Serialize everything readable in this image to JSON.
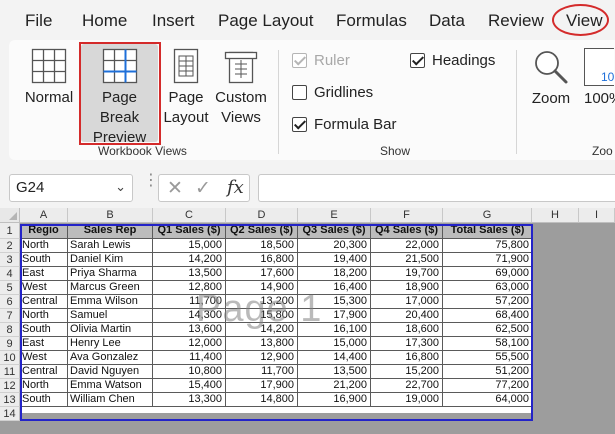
{
  "menu": {
    "items": [
      "File",
      "Home",
      "Insert",
      "Page Layout",
      "Formulas",
      "Data",
      "Review",
      "View"
    ],
    "active": "View"
  },
  "ribbon": {
    "workbook_views": {
      "label": "Workbook Views",
      "buttons": [
        {
          "line1": "Normal",
          "line2": "",
          "icon": "normal-view-icon"
        },
        {
          "line1": "Page Break",
          "line2": "Preview",
          "icon": "page-break-preview-icon",
          "selected": true
        },
        {
          "line1": "Page",
          "line2": "Layout",
          "icon": "page-layout-icon"
        },
        {
          "line1": "Custom",
          "line2": "Views",
          "icon": "custom-views-icon"
        }
      ]
    },
    "show": {
      "label": "Show",
      "ruler": {
        "label": "Ruler",
        "checked": true,
        "disabled": true
      },
      "gridlines": {
        "label": "Gridlines",
        "checked": false
      },
      "formula_bar": {
        "label": "Formula Bar",
        "checked": true
      },
      "headings": {
        "label": "Headings",
        "checked": true
      }
    },
    "zoom": {
      "label": "Zoo",
      "zoom_label": "Zoom",
      "hundred_label": "100%",
      "hundred_icon_text": "10"
    }
  },
  "formula_bar": {
    "name_box": "G24",
    "formula": "",
    "fx": "fx"
  },
  "grid": {
    "columns": [
      "A",
      "B",
      "C",
      "D",
      "E",
      "F",
      "G",
      "H",
      "I"
    ],
    "rows": [
      "1",
      "2",
      "3",
      "4",
      "5",
      "6",
      "7",
      "8",
      "9",
      "10",
      "11",
      "12",
      "13",
      "14"
    ],
    "watermark": "Page 1",
    "headers": [
      "Regio",
      "Sales Rep",
      "Q1 Sales ($)",
      "Q2 Sales ($)",
      "Q3 Sales ($)",
      "Q4 Sales ($)",
      "Total Sales ($)"
    ],
    "data": [
      [
        "North",
        "Sarah Lewis",
        "15,000",
        "18,500",
        "20,300",
        "22,000",
        "75,800"
      ],
      [
        "South",
        "Daniel Kim",
        "14,200",
        "16,800",
        "19,400",
        "21,500",
        "71,900"
      ],
      [
        "East",
        "Priya Sharma",
        "13,500",
        "17,600",
        "18,200",
        "19,700",
        "69,000"
      ],
      [
        "West",
        "Marcus Green",
        "12,800",
        "14,900",
        "16,400",
        "18,900",
        "63,000"
      ],
      [
        "Central",
        "Emma Wilson",
        "11,700",
        "13,200",
        "15,300",
        "17,000",
        "57,200"
      ],
      [
        "North",
        "Samuel",
        "14,300",
        "15,800",
        "17,900",
        "20,400",
        "68,400"
      ],
      [
        "South",
        "Olivia Martin",
        "13,600",
        "14,200",
        "16,100",
        "18,600",
        "62,500"
      ],
      [
        "East",
        "Henry Lee",
        "12,000",
        "13,800",
        "15,000",
        "17,300",
        "58,100"
      ],
      [
        "West",
        "Ava Gonzalez",
        "11,400",
        "12,900",
        "14,400",
        "16,800",
        "55,500"
      ],
      [
        "Central",
        "David Nguyen",
        "10,800",
        "11,700",
        "13,500",
        "15,200",
        "51,200"
      ],
      [
        "North",
        "Emma Watson",
        "15,400",
        "17,900",
        "21,200",
        "22,700",
        "77,200"
      ],
      [
        "South",
        "William Chen",
        "13,300",
        "14,800",
        "16,900",
        "19,000",
        "64,000"
      ]
    ]
  },
  "colors": {
    "accent_red": "#d42b2b",
    "page_border_blue": "#2323c8",
    "header_fill": "#bcbcbc",
    "outside_page_gray": "#9d9d9d"
  }
}
